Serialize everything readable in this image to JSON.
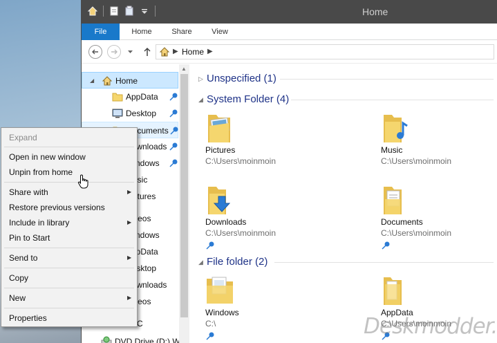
{
  "window": {
    "title": "Home",
    "ribbon_tabs": [
      "File",
      "Home",
      "Share",
      "View"
    ],
    "breadcrumb": "Home"
  },
  "nav_pane": {
    "items": [
      {
        "label": "Home",
        "icon": "home-icon"
      },
      {
        "label": "AppData",
        "icon": "folder-icon"
      },
      {
        "label": "Desktop",
        "icon": "desktop-icon"
      },
      {
        "label": "Documents",
        "icon": "documents-icon"
      },
      {
        "label": "Downloads",
        "icon": "downloads-icon"
      },
      {
        "label": "Windows",
        "icon": "folder-icon"
      },
      {
        "label": "Music",
        "icon": "music-icon"
      },
      {
        "label": "Pictures",
        "icon": "pictures-icon"
      },
      {
        "label": "Videos",
        "icon": "videos-icon"
      },
      {
        "label": "Windows",
        "icon": "folder-icon"
      },
      {
        "label": "AppData",
        "icon": "folder-icon"
      },
      {
        "label": "Desktop",
        "icon": "desktop-icon"
      },
      {
        "label": "Downloads",
        "icon": "downloads-icon"
      },
      {
        "label": "Videos",
        "icon": "videos-icon"
      },
      {
        "label": "C",
        "icon": "drive-icon"
      },
      {
        "label": "DVD Drive (D:) W",
        "icon": "dvd-icon"
      }
    ]
  },
  "content": {
    "groups": [
      {
        "title": "Unspecified (1)"
      },
      {
        "title": "System Folder (4)"
      },
      {
        "title": "File folder (2)"
      }
    ],
    "items": [
      {
        "name": "Pictures",
        "path": "C:\\Users\\moinmoin",
        "icon": "pictures-folder-icon"
      },
      {
        "name": "Music",
        "path": "C:\\Users\\moinmoin",
        "icon": "music-folder-icon"
      },
      {
        "name": "Downloads",
        "path": "C:\\Users\\moinmoin",
        "icon": "downloads-folder-icon"
      },
      {
        "name": "Documents",
        "path": "C:\\Users\\moinmoin",
        "icon": "documents-folder-icon"
      },
      {
        "name": "Windows",
        "path": "C:\\",
        "icon": "folder-icon"
      },
      {
        "name": "AppData",
        "path": "C:\\Users\\moinmoin",
        "icon": "folder-icon"
      }
    ]
  },
  "context_menu": {
    "items": [
      {
        "label": "Expand",
        "disabled": true
      },
      {
        "label": "Open in new window"
      },
      {
        "label": "Unpin from home"
      },
      {
        "label": "Share with",
        "submenu": true
      },
      {
        "label": "Restore previous versions"
      },
      {
        "label": "Include in library",
        "submenu": true
      },
      {
        "label": "Pin to Start"
      },
      {
        "label": "Send to",
        "submenu": true
      },
      {
        "label": "Copy"
      },
      {
        "label": "New",
        "submenu": true
      },
      {
        "label": "Properties"
      }
    ]
  },
  "watermark": "Deskmodder.de",
  "colors": {
    "file_tab": "#1979ca",
    "group_title": "#1e3287",
    "selection": "#cce8ff",
    "folder": "#f5d66e",
    "pin": "#2b7bd4"
  }
}
